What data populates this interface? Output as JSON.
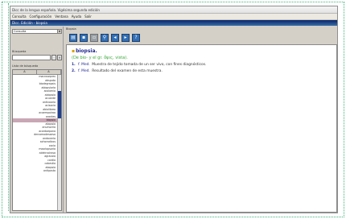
{
  "window": {
    "title": "Dicc de la lengua española. Vigésima segunda edición",
    "subtitle": "Dicc. Edición - biopsia"
  },
  "menu": [
    "Consulta",
    "Configuración",
    "Ventana",
    "Ayuda",
    "Salir"
  ],
  "left_panel": {
    "combo_value": "Consulta",
    "label_search": "Búsqueda",
    "label_results": "Lista de búsqueda",
    "columns": [
      "A",
      "A"
    ],
    "words": [
      "macroseprex",
      "abspota",
      "biodegrapsis",
      "abiopsiaria",
      "acolomia",
      "abiopsia",
      "acuante",
      "antivoaria",
      "acisocia",
      "abiolibreo",
      "acoempoiroa",
      "arantes",
      "biopsia",
      "abopsia",
      "anumorria",
      "acordoepona",
      "dercomodessesa",
      "andoveria",
      "achoradicos",
      "cocio",
      "mosriopsoria",
      "aldeircoirosa",
      "agracoia",
      "cardia",
      "cabestia",
      "abopsia",
      "antiposta"
    ],
    "selected_index": 12
  },
  "right_panel": {
    "label": "Biopsia",
    "toolbar": [
      "doc-icon",
      "save-icon",
      "print-icon",
      "zoom-icon",
      "back-icon",
      "forward-icon",
      "help-icon"
    ],
    "headword": "biopsia.",
    "etymology": "(De bio- y el gr. ὄψις, vista).",
    "definitions": [
      {
        "num": "1.",
        "abbr": "f. Med.",
        "text": "Muestra de tejido tomada de un ser vivo, con fines diagnósticos."
      },
      {
        "num": "2.",
        "abbr": "f. Med.",
        "text": "Resultado del examen de esta muestra."
      }
    ]
  }
}
